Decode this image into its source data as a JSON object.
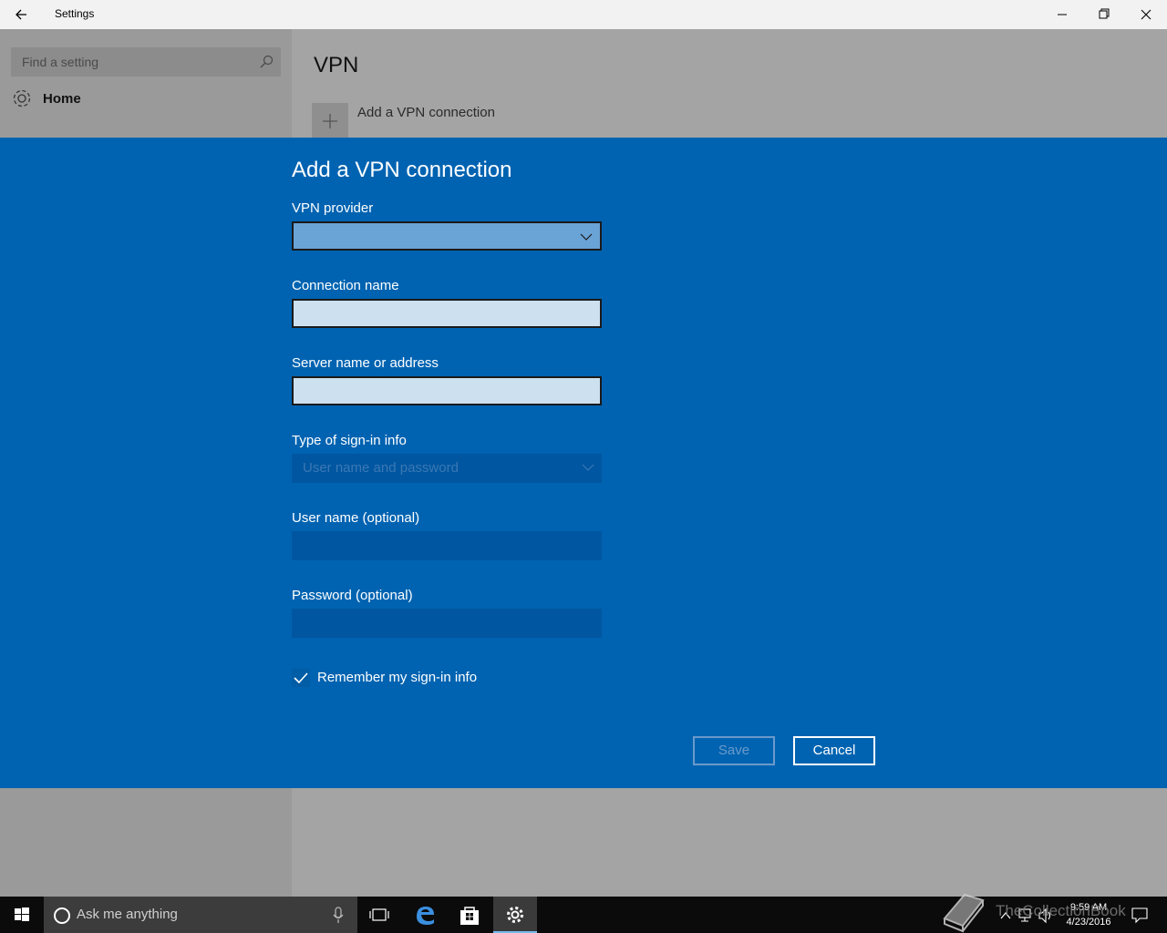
{
  "window": {
    "title": "Settings"
  },
  "sidebar": {
    "search_placeholder": "Find a setting",
    "home_label": "Home"
  },
  "main": {
    "page_title": "VPN",
    "add_connection_label": "Add a VPN connection"
  },
  "dialog": {
    "title": "Add a VPN connection",
    "vpn_provider_label": "VPN provider",
    "vpn_provider_value": "",
    "connection_name_label": "Connection name",
    "connection_name_value": "",
    "server_label": "Server name or address",
    "server_value": "",
    "signin_type_label": "Type of sign-in info",
    "signin_type_value": "User name and password",
    "username_label": "User name (optional)",
    "username_value": "",
    "password_label": "Password (optional)",
    "password_value": "",
    "remember_label": "Remember my sign-in info",
    "remember_checked": true,
    "save_label": "Save",
    "cancel_label": "Cancel"
  },
  "taskbar": {
    "search_placeholder": "Ask me anything",
    "time": "9:59 AM",
    "date": "4/23/2016",
    "watermark": "TheCollectionBook"
  },
  "colors": {
    "dialog_bg": "#0063b1",
    "accent": "#76b9ed"
  },
  "icons": [
    "back-arrow-icon",
    "minimize-icon",
    "maximize-icon",
    "close-icon",
    "search-icon",
    "gear-icon",
    "plus-icon",
    "chevron-down-icon",
    "checkmark-icon",
    "windows-logo-icon",
    "cortana-icon",
    "microphone-icon",
    "task-view-icon",
    "edge-icon",
    "store-icon",
    "settings-icon",
    "book-icon",
    "network-icon",
    "volume-icon",
    "notification-icon"
  ]
}
